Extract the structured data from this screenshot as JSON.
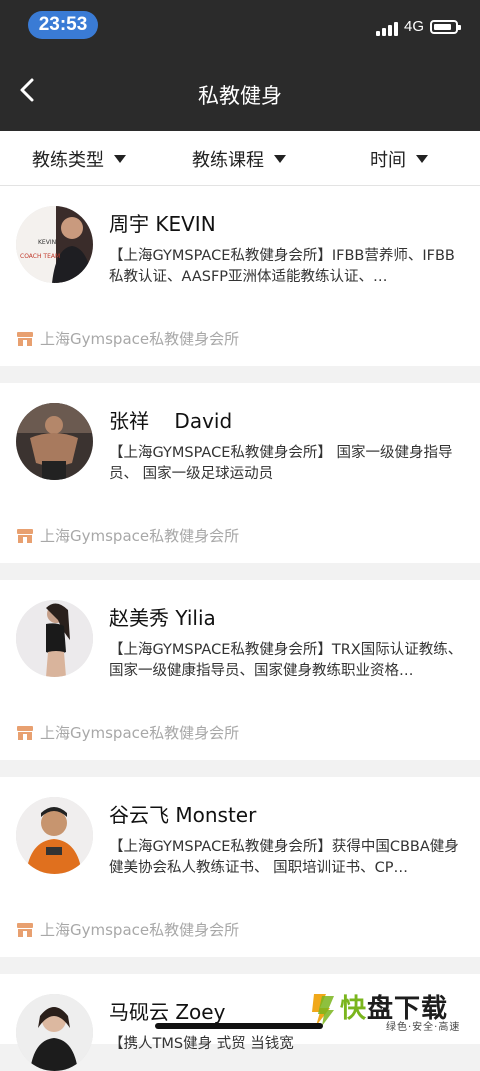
{
  "status": {
    "time": "23:53",
    "network": "4G"
  },
  "nav": {
    "title": "私教健身"
  },
  "filters": [
    {
      "label": "教练类型"
    },
    {
      "label": "教练课程"
    },
    {
      "label": "时间"
    }
  ],
  "coaches": [
    {
      "name": "周宇 KEVIN",
      "desc": "【上海GYMSPACE私教健身会所】IFBB营养师、IFBB私教认证、AASFP亚洲体适能教练认证、…",
      "venue": "上海Gymspace私教健身会所",
      "avatar_text": "KEVIN\nCOACH TEAM"
    },
    {
      "name": "张祥    David",
      "desc": "【上海GYMSPACE私教健身会所】 国家一级健身指导员、 国家一级足球运动员",
      "venue": "上海Gymspace私教健身会所",
      "avatar_text": ""
    },
    {
      "name": "赵美秀 Yilia",
      "desc": "【上海GYMSPACE私教健身会所】TRX国际认证教练、国家一级健康指导员、国家健身教练职业资格…",
      "venue": "上海Gymspace私教健身会所",
      "avatar_text": ""
    },
    {
      "name": "谷云飞 Monster",
      "desc": "【上海GYMSPACE私教健身会所】获得中国CBBA健身健美协会私人教练证书、 国职培训证书、CP…",
      "venue": "上海Gymspace私教健身会所",
      "avatar_text": ""
    },
    {
      "name": "马砚云 Zoey",
      "desc": "【携人TMS健身 式贸 当钱宽",
      "venue": "",
      "avatar_text": ""
    }
  ],
  "watermark": {
    "big_a": "快",
    "big_b": "盘下载",
    "small": "绿色·安全·高速"
  },
  "colors": {
    "navbar": "#2b2b2b",
    "venue_icon": "#e8a070",
    "time_pill": "#3a7bd5"
  }
}
